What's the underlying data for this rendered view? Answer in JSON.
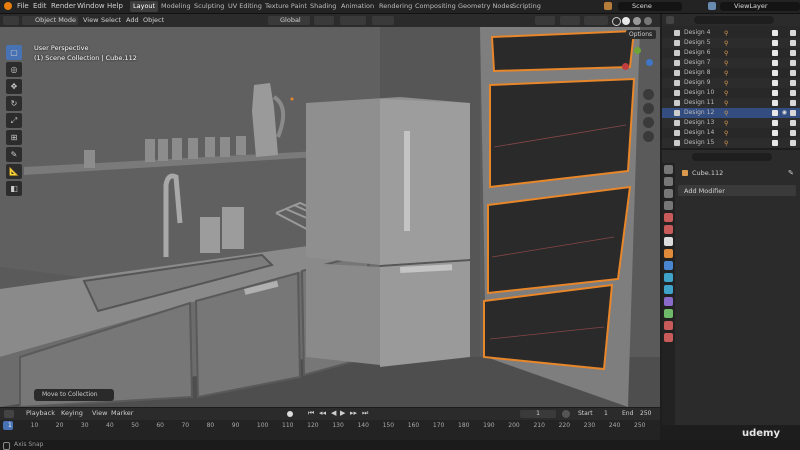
{
  "menu": {
    "file": "File",
    "edit": "Edit",
    "render": "Render",
    "window": "Window",
    "help": "Help"
  },
  "workspaces": [
    "Layout",
    "Modeling",
    "Sculpting",
    "UV Editing",
    "Texture Paint",
    "Shading",
    "Animation",
    "Rendering",
    "Compositing",
    "Geometry Nodes",
    "Scripting"
  ],
  "scene": "Scene",
  "view_layer": "ViewLayer",
  "viewport_header": {
    "mode": "Object Mode",
    "view": "View",
    "select": "Select",
    "add": "Add",
    "object": "Object",
    "orientation": "Global",
    "options": "Options"
  },
  "overlay": {
    "perspective": "User Perspective",
    "collection": "(1) Scene Collection | Cube.112"
  },
  "outliner": {
    "rows": [
      {
        "label": "Design 4",
        "selected": false
      },
      {
        "label": "Design 5",
        "selected": false
      },
      {
        "label": "Design 6",
        "selected": false
      },
      {
        "label": "Design 7",
        "selected": false
      },
      {
        "label": "Design 8",
        "selected": false
      },
      {
        "label": "Design 9",
        "selected": false
      },
      {
        "label": "Design 10",
        "selected": false
      },
      {
        "label": "Design 11",
        "selected": false
      },
      {
        "label": "Design 12",
        "selected": true
      },
      {
        "label": "Design 13",
        "selected": false
      },
      {
        "label": "Design 14",
        "selected": false
      },
      {
        "label": "Design 15",
        "selected": false
      }
    ]
  },
  "properties": {
    "object_name": "Cube.112",
    "add_modifier": "Add Modifier"
  },
  "operator_panel": "Move to Collection",
  "timeline": {
    "playback": "Playback",
    "keying": "Keying",
    "view": "View",
    "marker": "Marker",
    "current_frame": "1",
    "start_label": "Start",
    "start": "1",
    "end_label": "End",
    "end": "250",
    "ticks": [
      "1",
      "10",
      "20",
      "30",
      "40",
      "50",
      "60",
      "70",
      "80",
      "90",
      "100",
      "110",
      "120",
      "130",
      "140",
      "150",
      "160",
      "170",
      "180",
      "190",
      "200",
      "210",
      "220",
      "230",
      "240",
      "250"
    ]
  },
  "status": {
    "axis_snap": "Axis Snap"
  },
  "watermark": "udemy",
  "colors": {
    "accent": "#4772b3",
    "selection_outline": "#e8862a",
    "active_tab": "#3d3d3d"
  }
}
